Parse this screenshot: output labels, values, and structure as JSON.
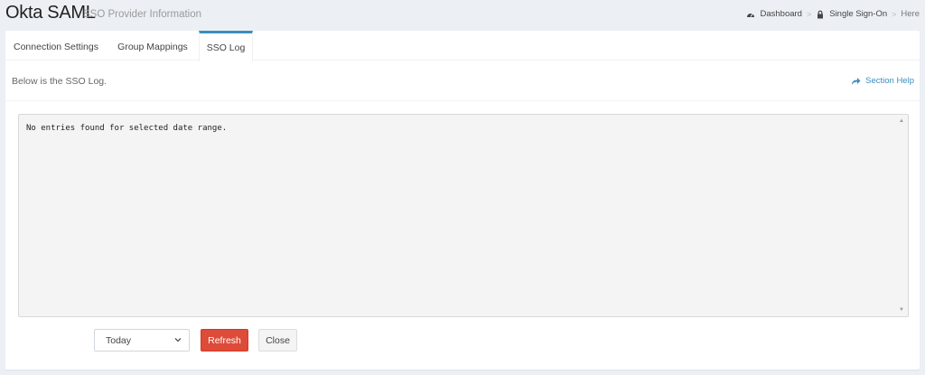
{
  "header": {
    "title": "Okta SAML",
    "subtitle": "SSO Provider Information"
  },
  "breadcrumb": [
    {
      "label": "Dashboard",
      "icon": "dashboard-icon"
    },
    {
      "label": "Single Sign-On",
      "icon": "lock-icon"
    },
    {
      "label": "Here"
    }
  ],
  "tabs": [
    {
      "label": "Connection Settings",
      "active": false
    },
    {
      "label": "Group Mappings",
      "active": false
    },
    {
      "label": "SSO Log",
      "active": true
    }
  ],
  "content": {
    "intro": "Below is the SSO Log.",
    "help_label": "Section Help",
    "log_text": "No entries found for selected date range."
  },
  "controls": {
    "date_range": "Today",
    "refresh_label": "Refresh",
    "close_label": "Close"
  },
  "colors": {
    "accent": "#3c8dbc",
    "danger": "#dd4b39",
    "page_bg": "#ecf0f5"
  }
}
